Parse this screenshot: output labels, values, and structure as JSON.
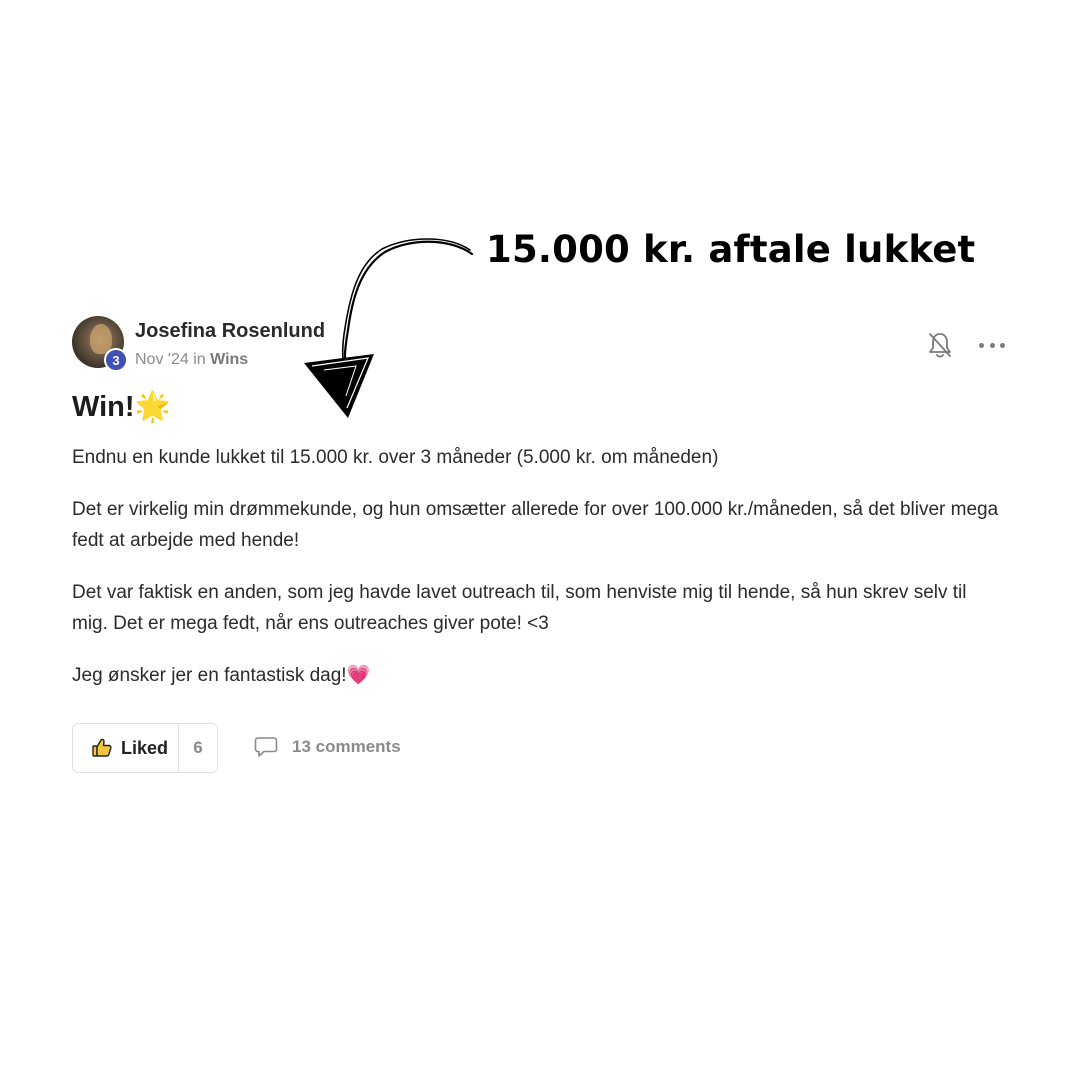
{
  "annotation": {
    "headline": "15.000 kr. aftale lukket"
  },
  "post": {
    "author": {
      "name": "Josefina Rosenlund",
      "level": "3"
    },
    "meta": {
      "date": "Nov '24",
      "in_word": "in",
      "category": "Wins"
    },
    "title": "Win!",
    "title_emoji": "🌟",
    "paragraphs": [
      "Endnu en kunde lukket til 15.000 kr. over 3 måneder (5.000 kr. om måneden)",
      "Det er virkelig min drømmekunde, og hun omsætter allerede for over 100.000 kr./måneden, så det bliver mega fedt at arbejde med hende!",
      "Det var faktisk en anden, som jeg havde lavet outreach til, som henviste mig til hende, så hun skrev selv til mig. Det er mega fedt, når ens outreaches giver pote! <3",
      "Jeg ønsker jer en fantastisk dag!"
    ],
    "closing_emoji": "💗",
    "actions": {
      "like_label": "Liked",
      "like_count": "6",
      "comments_label": "13 comments"
    },
    "icons": {
      "notification": "bell-off-icon",
      "more": "more-horizontal-icon",
      "like": "thumbs-up-icon",
      "comment": "comment-bubble-icon"
    }
  }
}
